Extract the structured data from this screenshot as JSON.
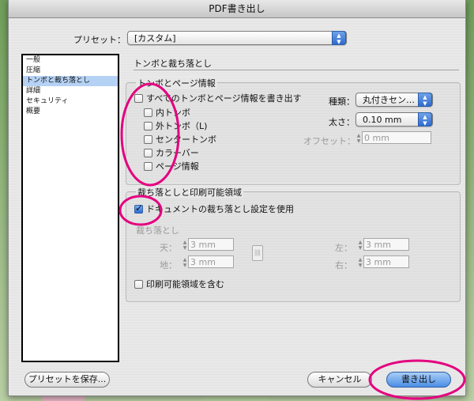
{
  "window": {
    "title": "PDF書き出し"
  },
  "preset": {
    "label": "プリセット：",
    "value": "[カスタム]"
  },
  "sidebar": {
    "items": [
      {
        "label": "一般"
      },
      {
        "label": "圧縮"
      },
      {
        "label": "トンボと裁ち落とし",
        "selected": true
      },
      {
        "label": "詳細"
      },
      {
        "label": "セキュリティ"
      },
      {
        "label": "概要"
      }
    ]
  },
  "section": {
    "title": "トンボと裁ち落とし"
  },
  "marks": {
    "group_title": "トンボとページ情報",
    "all_marks": "すべてのトンボとページ情報を書き出す",
    "crop": "内トンボ",
    "bleed": "外トンボ（L)",
    "registration": "センタートンボ",
    "color_bars": "カラーバー",
    "page_info": "ページ情報",
    "type_label": "種類：",
    "type_value": "丸付きセン…",
    "weight_label": "太さ：",
    "weight_value": "0.10 mm",
    "offset_label": "オフセット：",
    "offset_value": "0 mm"
  },
  "bleed": {
    "group_title": "裁ち落としと印刷可能領域",
    "use_document": "ドキュメントの裁ち落とし設定を使用",
    "use_document_checked": true,
    "subtitle": "裁ち落とし",
    "top_label": "天：",
    "top_value": "3 mm",
    "bottom_label": "地：",
    "bottom_value": "3 mm",
    "left_label": "左：",
    "left_value": "3 mm",
    "right_label": "右：",
    "right_value": "3 mm",
    "slug": "印刷可能領域を含む"
  },
  "buttons": {
    "save_preset": "プリセットを保存...",
    "cancel": "キャンセル",
    "export": "書き出し"
  },
  "colors": {
    "annotation": "#e4007f",
    "selection": "#b5d2f5",
    "accent": "#2e6bd0"
  }
}
